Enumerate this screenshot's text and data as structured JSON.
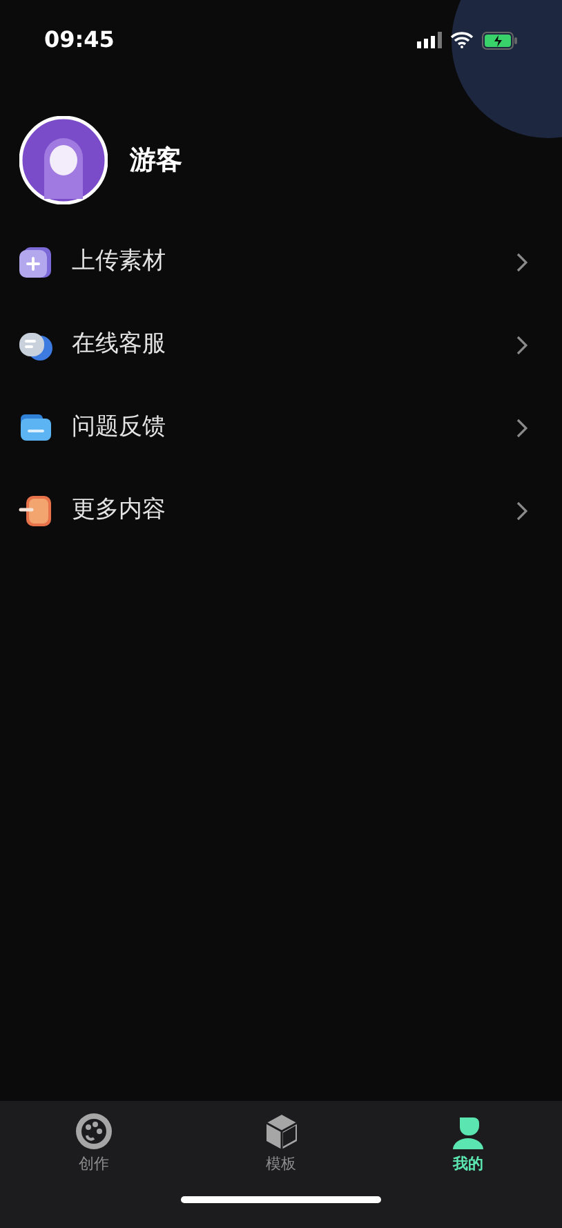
{
  "status_bar": {
    "time": "09:45"
  },
  "profile": {
    "name": "游客"
  },
  "menu": [
    {
      "label": "上传素材",
      "kind": "upload"
    },
    {
      "label": "在线客服",
      "kind": "service"
    },
    {
      "label": "问题反馈",
      "kind": "feedback"
    },
    {
      "label": "更多内容",
      "kind": "more"
    }
  ],
  "tab_bar": [
    {
      "label": "创作",
      "kind": "palette",
      "selected": false
    },
    {
      "label": "模板",
      "kind": "cube",
      "selected": false
    },
    {
      "label": "我的",
      "kind": "person",
      "selected": true
    }
  ]
}
